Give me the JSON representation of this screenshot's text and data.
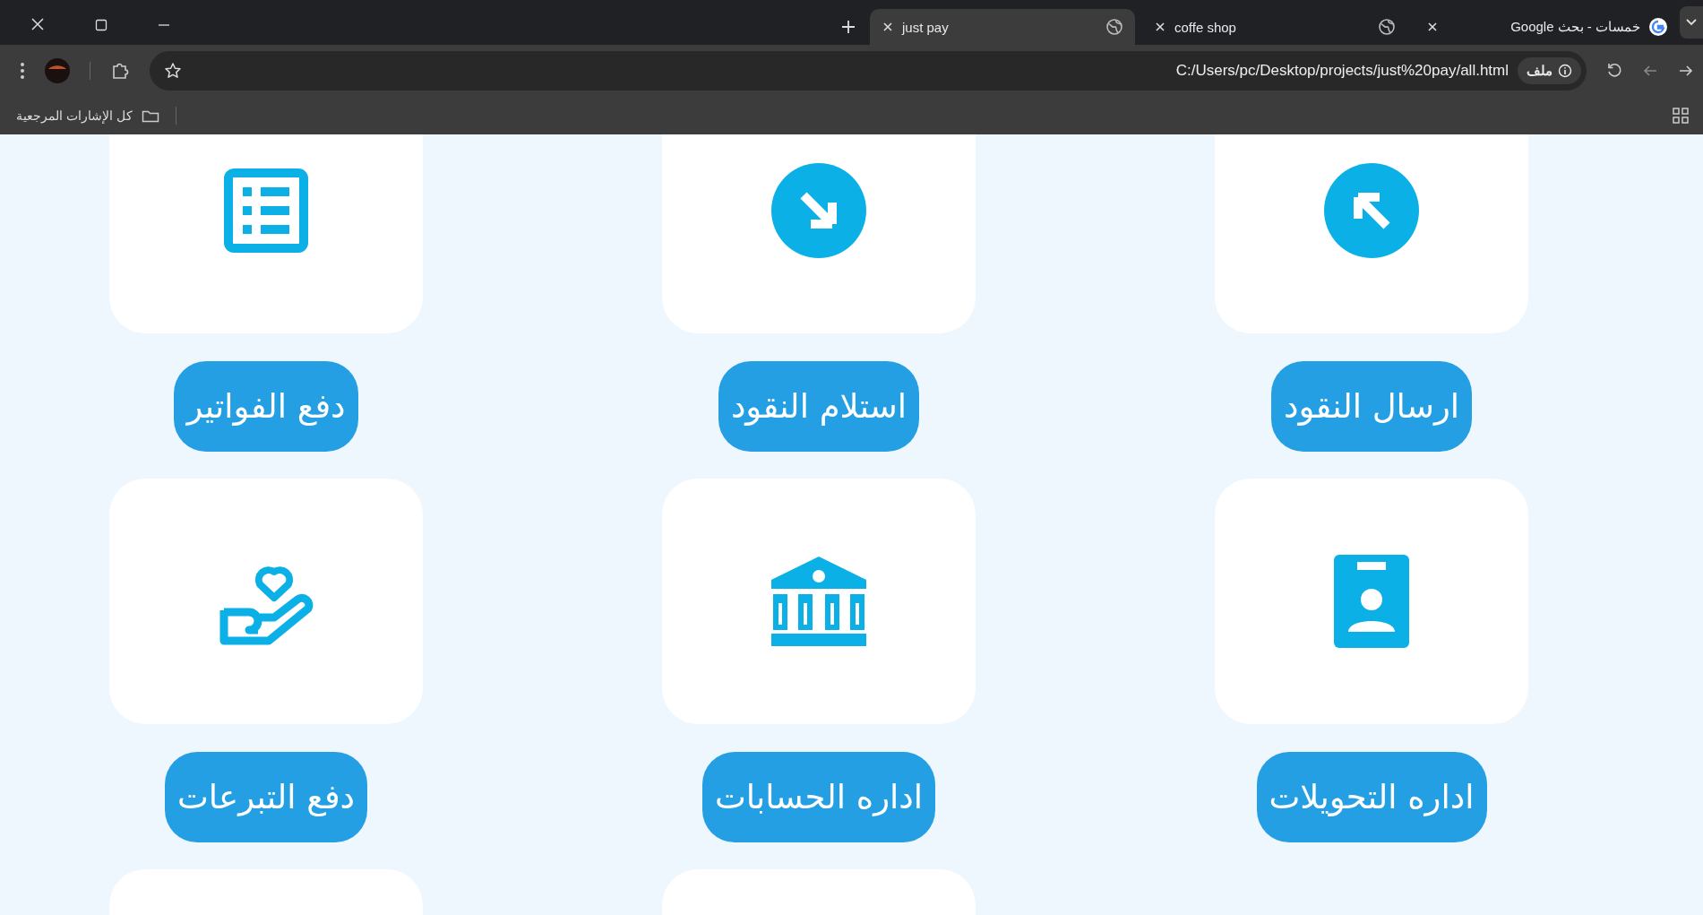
{
  "browser": {
    "tabs": [
      {
        "title": "خمسات - بحث Google",
        "selected": false
      },
      {
        "title": "coffe shop",
        "selected": false
      },
      {
        "title": "just pay",
        "selected": true
      }
    ],
    "address": "C:/Users/pc/Desktop/projects/just%20pay/all.html",
    "site_chip": "ملف",
    "bookmarks_folder": "كل الإشارات المرجعية"
  },
  "services": [
    {
      "label": "ارسال النقود"
    },
    {
      "label": "استلام النقود"
    },
    {
      "label": "دفع الفواتير"
    },
    {
      "label": "اداره التحويلات"
    },
    {
      "label": "اداره الحسابات"
    },
    {
      "label": "دفع التبرعات"
    }
  ]
}
